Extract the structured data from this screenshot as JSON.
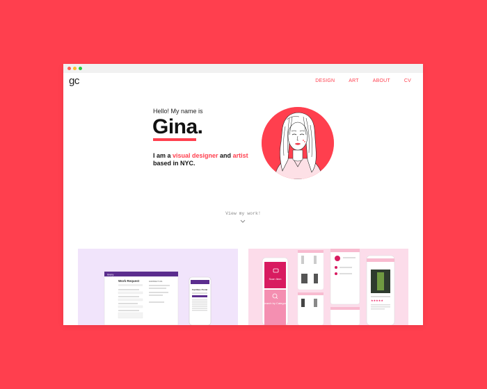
{
  "window": {
    "controls": [
      "close",
      "minimize",
      "maximize"
    ]
  },
  "header": {
    "logo": "gc",
    "nav": [
      {
        "label": "DESIGN"
      },
      {
        "label": "ART"
      },
      {
        "label": "ABOUT"
      },
      {
        "label": "CV"
      }
    ]
  },
  "hero": {
    "greeting": "Hello! My name is",
    "name": "Gina.",
    "intro_prefix": "I am a ",
    "intro_highlight1": "visual designer",
    "intro_mid": " and ",
    "intro_highlight2": "artist",
    "intro_suffix": "based in NYC."
  },
  "cta": {
    "view_work": "View my work!"
  },
  "colors": {
    "accent": "#ff3f4e",
    "page_bg": "#ff3f4e",
    "card_left": "#f1e4fb",
    "card_right": "#fcdcea"
  },
  "icons": {
    "chevron": "chevron-down-icon",
    "avatar": "portrait-illustration"
  },
  "portfolio": {
    "card1": {
      "brand": "ilvery",
      "form_title": "Work Request",
      "side_heading": "CONTACT US",
      "phone_title": "Facilities Portal"
    },
    "card2": {
      "scan_label": "Scan Item",
      "search_label": "Search by Category"
    }
  }
}
